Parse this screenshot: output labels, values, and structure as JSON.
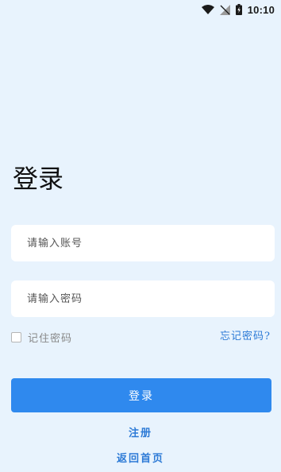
{
  "status_bar": {
    "time": "10:10",
    "icons": [
      "wifi-icon",
      "signal-icon",
      "battery-icon"
    ]
  },
  "login": {
    "title": "登录",
    "account_placeholder": "请输入账号",
    "password_placeholder": "请输入密码",
    "remember_label": "记住密码",
    "forgot_label": "忘记密码?",
    "submit_label": "登录",
    "register_label": "注册",
    "back_home_label": "返回首页"
  },
  "colors": {
    "background": "#e8f3fd",
    "accent": "#2f89ee",
    "link": "#2c7ad6"
  }
}
